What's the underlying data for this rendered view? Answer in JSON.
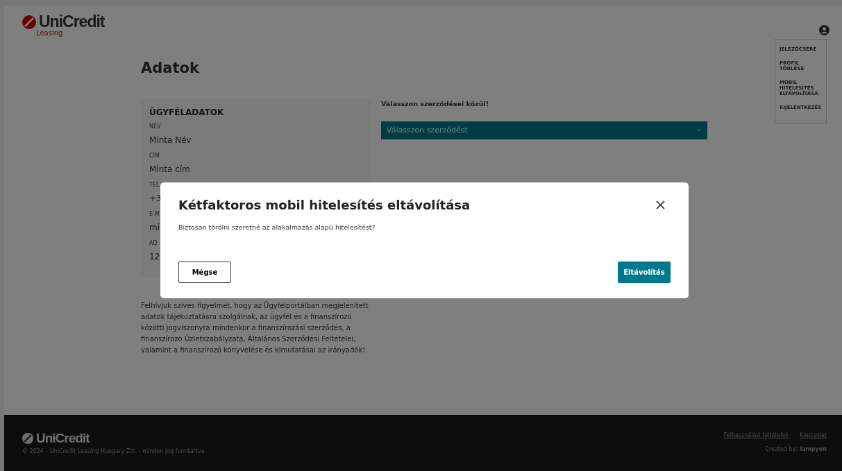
{
  "header": {
    "logo": "UniCredit",
    "logo_sub": "Leasing"
  },
  "user_menu": [
    {
      "label": "JELSZÓCSERE"
    },
    {
      "label": "PROFIL TÖRLÉSE"
    },
    {
      "label": "MOBIL HITELESÍTÉS ELTÁVOLÍTÁSA"
    },
    {
      "label": "KIJELENTKEZÉS"
    }
  ],
  "page_title": "Adatok",
  "customer_card": {
    "title": "ÜGYFÉLADATOK",
    "fields": [
      {
        "label": "NÉV",
        "value": "Minta Név"
      },
      {
        "label": "CÍM",
        "value": "Minta cím"
      },
      {
        "label": "TEL",
        "value": "+3"
      },
      {
        "label": "E-M",
        "value": "mi"
      },
      {
        "label": "AD",
        "value": "12"
      }
    ]
  },
  "notice": "Felhívjuk szíves figyelmét, hogy az Ügyfélportálban megjelenített adatok tájékoztatásra szolgálnak, az ügyfél és a finanszírozó közötti jogviszonyra mindenkor a finanszírozási szerződés, a finanszírozó Üzletszabályzata, Általános Szerződési Feltételei, valamint a finanszírozó könyvelése és kimutatásai az irányadók!",
  "contract_select": {
    "label": "Válasszon szerződései közül!",
    "placeholder": "Válasszon szerződést"
  },
  "footer": {
    "logo": "UniCredit",
    "copyright": "© 2024 – UniCredit Leasing Hungary Zrt. – minden jog fenntartva",
    "links": [
      "Felhasználási feltételek",
      "Kapcsolat"
    ],
    "created_by": "Created by:",
    "creator": "lampyon"
  },
  "modal": {
    "title": "Kétfaktoros mobil hitelesítés eltávolítása",
    "body": "Biztosan törölni szeretné az alakalmazás alapú hitelesítést?",
    "cancel": "Mégse",
    "confirm": "Eltávolítás"
  }
}
